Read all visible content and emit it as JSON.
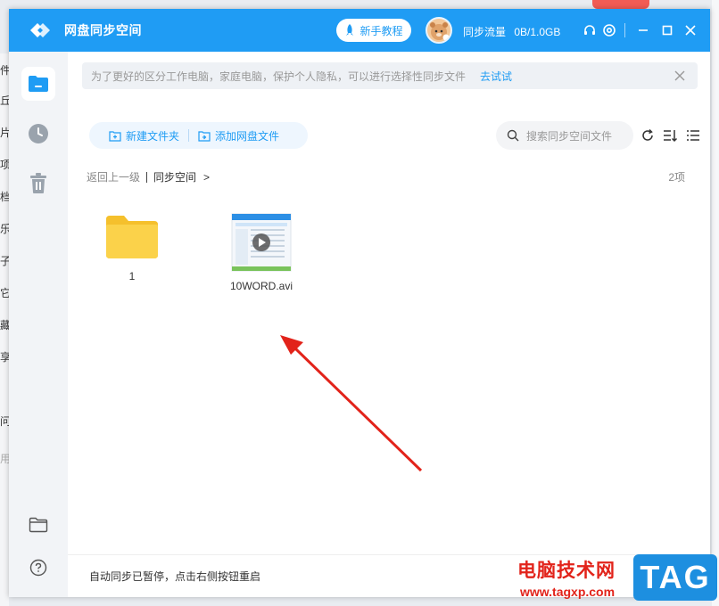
{
  "app": {
    "title": "网盘同步空间"
  },
  "header": {
    "tutorial_label": "新手教程",
    "traffic_label": "同步流量",
    "traffic_value": "0B/1.0GB"
  },
  "notice": {
    "text": "为了更好的区分工作电脑，家庭电脑，保护个人隐私，可以进行选择性同步文件",
    "try_label": "去试试"
  },
  "toolbar": {
    "new_folder_label": "新建文件夹",
    "add_file_label": "添加网盘文件",
    "search_placeholder": "搜索同步空间文件"
  },
  "breadcrumb": {
    "back_label": "返回上一级",
    "current": "同步空间",
    "arrow": ">"
  },
  "count_label": "2项",
  "files": [
    {
      "name": "1",
      "type": "folder"
    },
    {
      "name": "10WORD.avi",
      "type": "video"
    }
  ],
  "status": {
    "text": "自动同步已暂停，点击右侧按钮重启"
  },
  "watermark": {
    "text": "电脑技术网",
    "url": "www.tagxp.com",
    "tag": "TAG"
  },
  "background_strip": [
    "件",
    "丘",
    "片",
    "项",
    "档",
    "乐",
    "子",
    "它",
    "藏",
    "享",
    "问",
    "用"
  ],
  "colors": {
    "accent": "#1f9cf4",
    "folder": "#fbd24a",
    "arrow": "#e2231a"
  }
}
